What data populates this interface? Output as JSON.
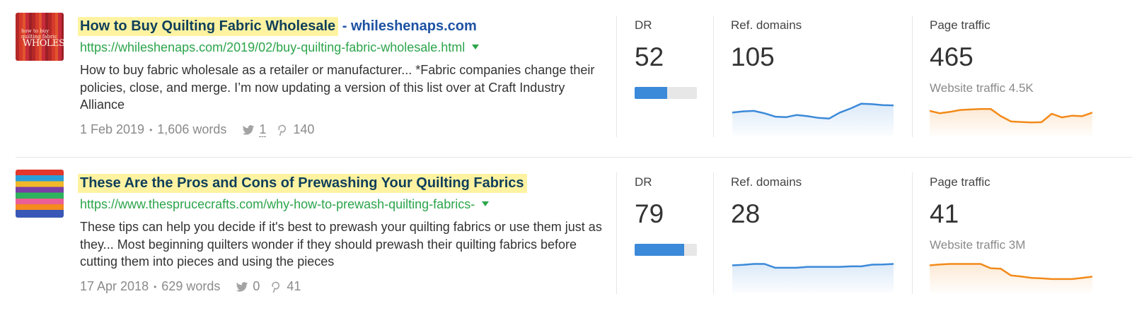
{
  "results": [
    {
      "title": "How to Buy Quilting Fabric Wholesale",
      "title_separator": "-",
      "domain": "whileshenaps.com",
      "url": "https://whileshenaps.com/2019/02/buy-quilting-fabric-wholesale.html",
      "snippet": "How to buy fabric wholesale as a retailer or manufacturer... *Fabric companies change their policies, close, and merge. I’m now updating a version of this list over at Craft Industry Alliance",
      "date": "1 Feb 2019",
      "words": "1,606 words",
      "tweets": "1",
      "pins": "140",
      "dr_label": "DR",
      "dr": "52",
      "dr_fraction": 0.52,
      "ref_domains_label": "Ref. domains",
      "ref_domains": "105",
      "page_traffic_label": "Page traffic",
      "page_traffic": "465",
      "website_traffic": "Website traffic 4.5K",
      "thumb_text": "WHOLESALE",
      "thumb_small_text": "how to buy quilting fabric",
      "ref_domains_trend": [
        0.55,
        0.6,
        0.62,
        0.52,
        0.38,
        0.36,
        0.45,
        0.4,
        0.33,
        0.3,
        0.55,
        0.72,
        0.92,
        0.9,
        0.86,
        0.85
      ],
      "page_traffic_trend": [
        0.62,
        0.52,
        0.58,
        0.66,
        0.68,
        0.7,
        0.7,
        0.4,
        0.18,
        0.16,
        0.14,
        0.15,
        0.5,
        0.35,
        0.42,
        0.4,
        0.55
      ]
    },
    {
      "title": "These Are the Pros and Cons of Prewashing Your Quilting Fabrics",
      "url": "https://www.thesprucecrafts.com/why-how-to-prewash-quilting-fabrics-",
      "snippet": "These tips can help you decide if it's best to prewash your quilting fabrics or use them just as they... Most beginning quilters wonder if they should prewash their quilting fabrics before cutting them into pieces and using the pieces",
      "date": "17 Apr 2018",
      "words": "629 words",
      "tweets": "0",
      "pins": "41",
      "dr_label": "DR",
      "dr": "79",
      "dr_fraction": 0.79,
      "ref_domains_label": "Ref. domains",
      "ref_domains": "28",
      "page_traffic_label": "Page traffic",
      "page_traffic": "41",
      "website_traffic": "Website traffic 3M",
      "ref_domains_trend": [
        0.72,
        0.74,
        0.78,
        0.78,
        0.62,
        0.62,
        0.62,
        0.66,
        0.66,
        0.66,
        0.66,
        0.68,
        0.68,
        0.75,
        0.76,
        0.78
      ],
      "page_traffic_trend": [
        0.72,
        0.76,
        0.78,
        0.78,
        0.78,
        0.78,
        0.6,
        0.58,
        0.3,
        0.26,
        0.2,
        0.18,
        0.15,
        0.15,
        0.15,
        0.2,
        0.25
      ]
    }
  ],
  "colors": {
    "title_highlight": "#fff3a2",
    "title_text": "#0e3f5b",
    "domain_text": "#1d52a3",
    "url_green": "#2ca54b",
    "dr_fill": "#3b89d9",
    "ref_domains_line": "#3b89d9",
    "page_traffic_line": "#f28a1a"
  },
  "icons": {
    "twitter": "twitter-icon",
    "pinterest": "pinterest-icon",
    "url_menu": "chevron-down-icon"
  }
}
